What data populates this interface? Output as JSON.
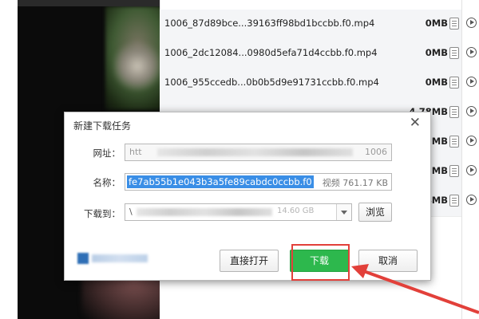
{
  "colors": {
    "accent_green": "#2db84d",
    "selection_blue": "#3a8ee6",
    "annotation_red": "#e2403a"
  },
  "download_list": {
    "items": [
      {
        "name": "1006_87d89bce...39163ff98bd1bccbb.f0.mp4",
        "size": "0MB"
      },
      {
        "name": "1006_2dc12084...0980d5efa71d4ccbb.f0.mp4",
        "size": "0MB"
      },
      {
        "name": "1006_955ccedb...0b0b5d9e91731ccbb.f0.mp4",
        "size": "0MB"
      },
      {
        "name": "",
        "size": "4.78MB"
      },
      {
        "name": "",
        "size": "99MB"
      },
      {
        "name": "",
        "size": "59MB"
      },
      {
        "name": "",
        "size": "74MB"
      }
    ],
    "file_icon": "file-icon",
    "play_icon": "play-icon"
  },
  "dialog": {
    "title": "新建下载任务",
    "close_icon": "close-icon",
    "url_label": "网址：",
    "url_prefix": "htt",
    "url_suffix": "1006",
    "name_label": "名称：",
    "name_value": "fe7ab55b1e043b3a5fe89cabdc0ccbb.f0",
    "file_info": "视频 761.17 KB",
    "saveto_label": "下载到：",
    "path_prefix": "\\",
    "free_space": "14.60 GB",
    "browse_button": "浏览",
    "open_button": "直接打开",
    "download_button": "下载",
    "cancel_button": "取消"
  }
}
